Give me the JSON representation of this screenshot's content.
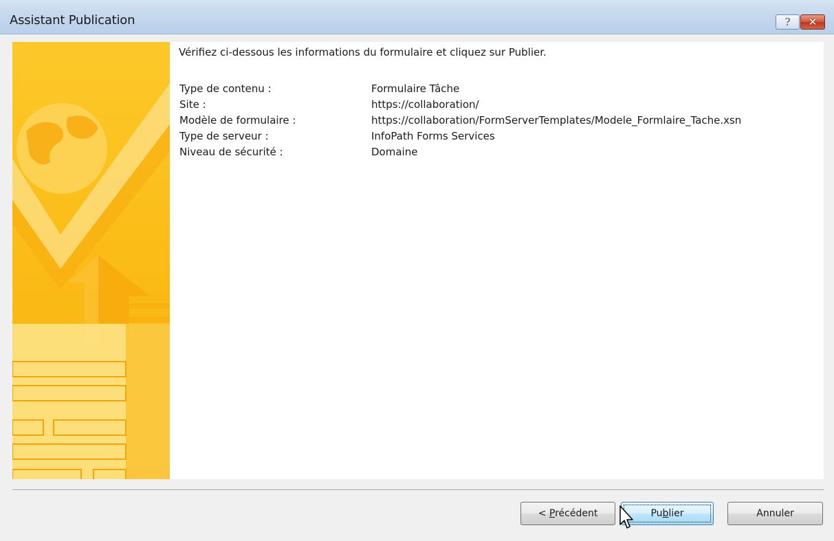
{
  "window": {
    "title": "Assistant Publication",
    "help_glyph": "?",
    "close_glyph": "✕"
  },
  "main": {
    "intro": "Vérifiez ci-dessous les informations du formulaire et cliquez sur Publier.",
    "fields": [
      {
        "label": "Type de contenu :",
        "value": "Formulaire Tâche"
      },
      {
        "label": "Site :",
        "value": "https://collaboration/"
      },
      {
        "label": "Modèle de formulaire :",
        "value": "https://collaboration/FormServerTemplates/Modele_Formlaire_Tache.xsn"
      },
      {
        "label": "Type de serveur :",
        "value": "InfoPath Forms Services"
      },
      {
        "label": "Niveau de sécurité :",
        "value": "Domaine"
      }
    ]
  },
  "buttons": {
    "previous": {
      "before": "< ",
      "accel": "P",
      "after": "récédent"
    },
    "publish": {
      "before": "Pu",
      "accel": "b",
      "after": "lier"
    },
    "cancel": "Annuler"
  },
  "colors": {
    "banner": "#fbbd18",
    "titlebar": "#c5d8ee",
    "close_button": "#c1351a"
  },
  "icons": [
    "help-icon",
    "close-icon",
    "mouse-cursor-icon"
  ]
}
